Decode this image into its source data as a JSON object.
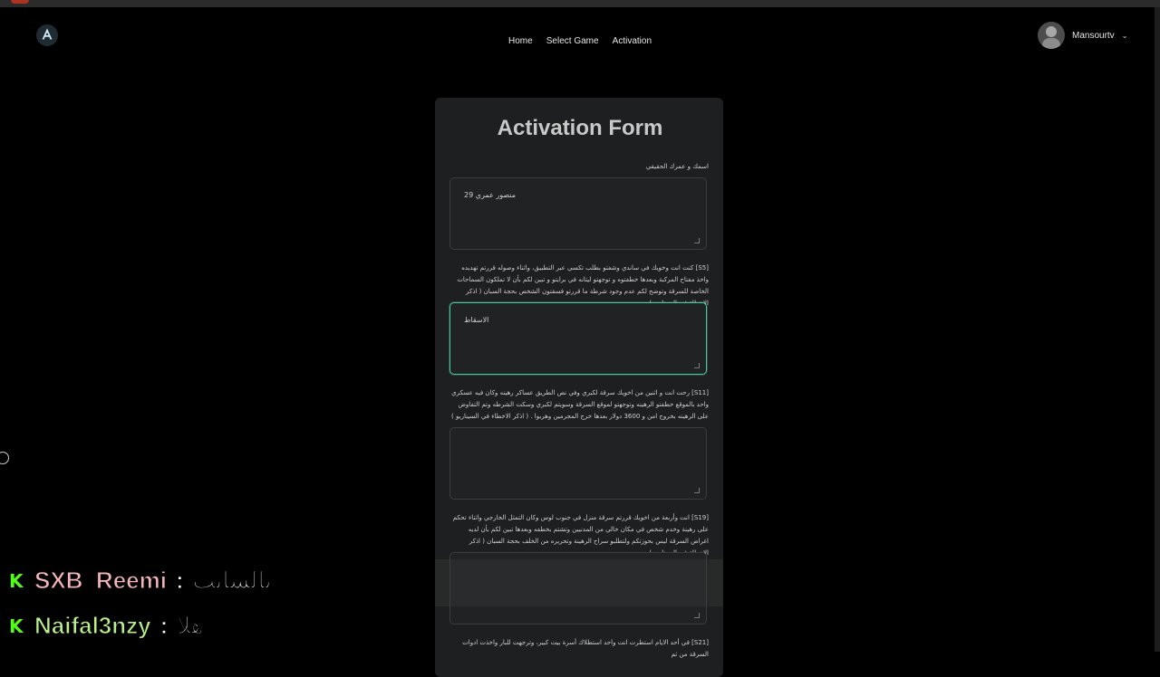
{
  "nav": {
    "links": [
      "Home",
      "Select Game",
      "Activation"
    ],
    "username": "Mansourtv"
  },
  "form": {
    "title": "Activation Form",
    "questions": [
      {
        "label": "اسمك و عمرك الحقيقي",
        "value": "منصور عمري 29"
      },
      {
        "label": "[S5] كنت انت وخويك في ساندي وشفتو بطلب تكسي عبر التطبيق، واثناء وصوله قررتم تهديده واخذ مفتاح المركبة وبعدها خطفتوه و توجهتو ليتانه في برايتو و تبين لكم بأن لا تملكون السماحات الخاصة للسرقة وتوضح لكم عدم وجود شرطة ما قررتو فسقتون الشخص بحجة السبان ( اذكر الاخطاء في السيناريو )",
        "value": "الاسقاط"
      },
      {
        "label": "[S11] رحت انت و اثنين من اخويك سرقة لكبري وفي نص الطريق عساكر رهينه وكان فيه عسكري واحد بالموقع خطفتو الرهينه وتوجهتو لموقع السرقة وسويتم لكبري وسكت الشرطه وتم التفاوض على الرهينه بخروج امن و 3600 دولار بعدها خرج المجرمين وهربوا . ( اذكر الاخطاء في السيناريو )",
        "value": ""
      },
      {
        "label": "[S19] انت وأربعة من اخويك قررتم سرقة منزل في جنوب لوس وكان التمثل الخارجي واثناء تحكم على رهينة وخدم شخص في مكان خالي من المدنيين وتشتم بخطفه وبعدها تبين لكم بأن لديه اغراض السرقة ليس بحوزتكم ولتطلبو سراح الرهينة وتحريره من الخلف بحجة السبان ( اذكر الاخطاء في السيناريو )",
        "value": ""
      },
      {
        "label": "[S21] في أحد الايام استطرت انت واحد استطلاك أسرة بيت كبير، وترجهت للبار واخذت ادوات السرقة من ثم",
        "value": ""
      }
    ]
  },
  "chat": [
    {
      "user": "SXB_Reemi",
      "separator": ":",
      "message": "يالشايب"
    },
    {
      "user": "Naifal3nzy",
      "separator": ":",
      "message": "هلا"
    }
  ],
  "colors": {
    "focus": "#49c69a",
    "kick": "#53fc18"
  }
}
